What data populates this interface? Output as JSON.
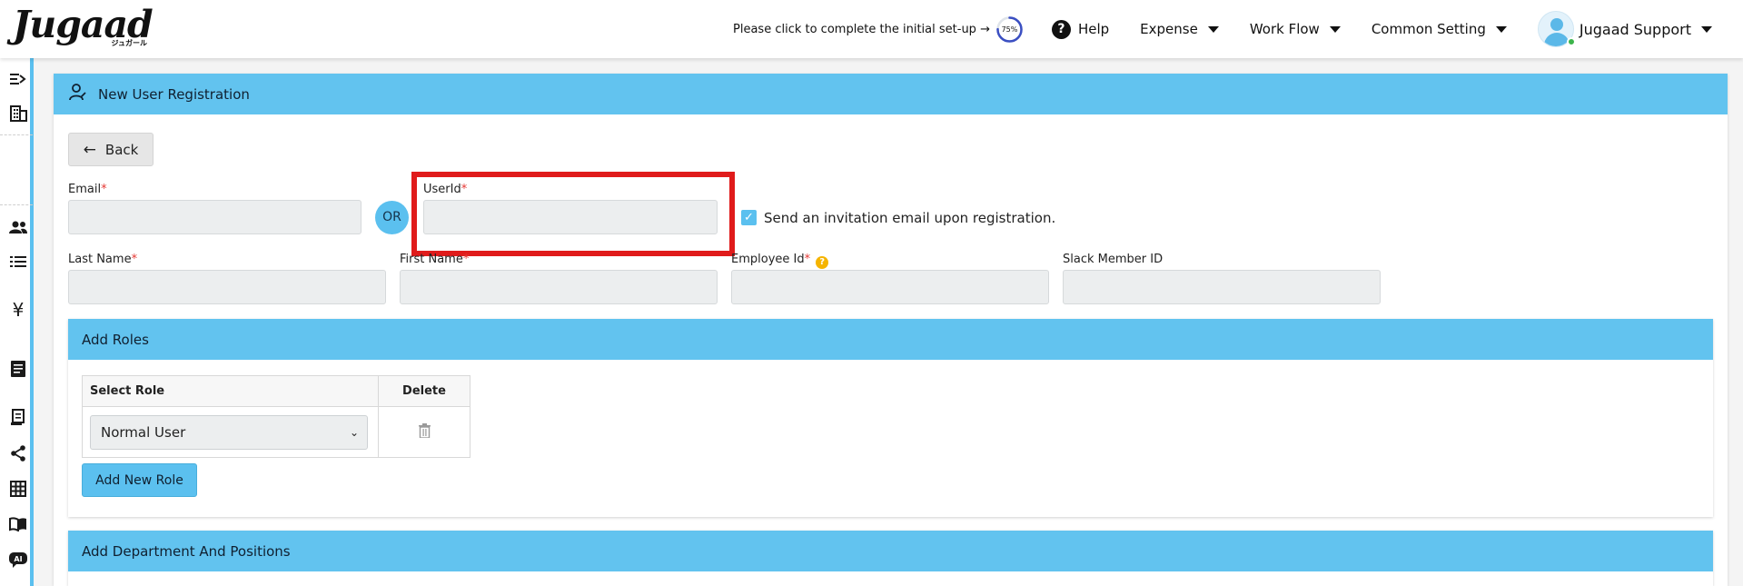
{
  "app": {
    "logo_text": "Jugaad",
    "logo_sub": "ジュガール"
  },
  "navbar": {
    "setup_text": "Please click to complete the initial set-up →",
    "setup_progress": "75%",
    "setup_progress_value": 75,
    "help_label": "Help",
    "menus": [
      "Expense",
      "Work Flow",
      "Common Setting"
    ],
    "user_name": "Jugaad Support"
  },
  "page": {
    "title": "New User Registration",
    "back_label": "Back"
  },
  "form": {
    "email_label": "Email",
    "or_label": "OR",
    "userid_label": "UserId",
    "invite_label": "Send an invitation email upon registration.",
    "invite_checked": true,
    "last_name_label": "Last Name",
    "first_name_label": "First Name",
    "employee_id_label": "Employee Id",
    "slack_label": "Slack Member ID",
    "required_mark": "*"
  },
  "roles": {
    "section_title": "Add Roles",
    "col_role": "Select Role",
    "col_delete": "Delete",
    "selected_role": "Normal User",
    "add_button": "Add New Role"
  },
  "departments": {
    "section_title": "Add Department And Positions"
  },
  "colors": {
    "accent": "#5bc0ef",
    "header_bar": "#62c3ef",
    "highlight": "#e01b1b",
    "required": "#e53935"
  },
  "sidebar_icons": [
    "menu-expand-icon",
    "building-icon",
    "users-icon",
    "list-icon",
    "yen-icon",
    "document-icon",
    "receipt-icon",
    "share-icon",
    "grid-icon",
    "book-icon",
    "ai-chat-icon"
  ]
}
